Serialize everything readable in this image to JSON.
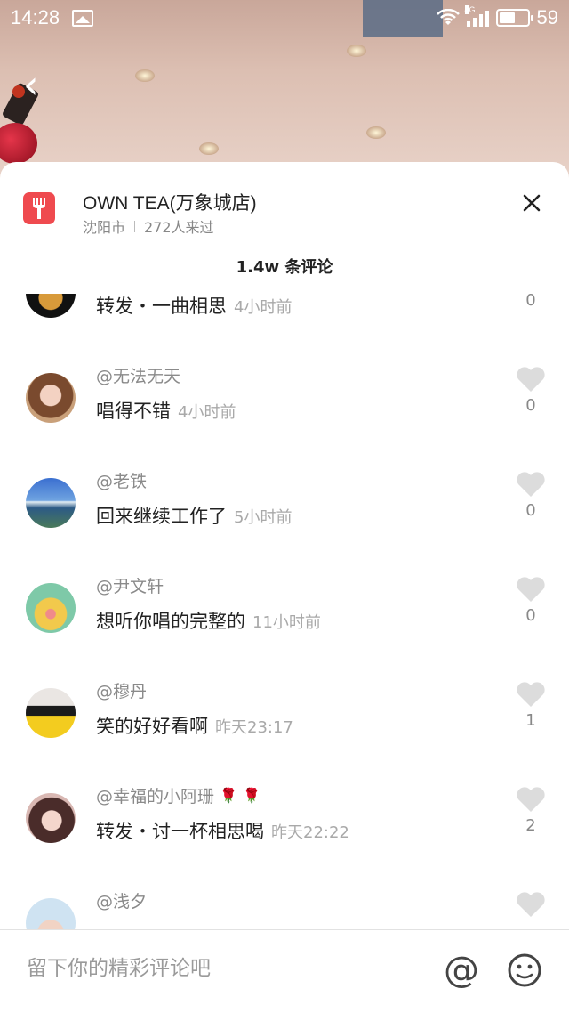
{
  "status_bar": {
    "time": "14:28",
    "network": "4G",
    "battery": "59",
    "battery_level": 0.59
  },
  "header": {
    "back_icon": "chevron-left-icon"
  },
  "shop": {
    "icon": "fork-icon",
    "name": "OWN TEA(万象城店)",
    "city": "沈阳市",
    "visitors": "272人来过"
  },
  "comments_title": "1.4w 条评论",
  "comments": [
    {
      "user": "",
      "text": "转发・一曲相思",
      "time": "4小时前",
      "likes": "0"
    },
    {
      "user": "@无法无天",
      "text": "唱得不错",
      "time": "4小时前",
      "likes": "0"
    },
    {
      "user": "@老铁",
      "text": "回来继续工作了",
      "time": "5小时前",
      "likes": "0"
    },
    {
      "user": "@尹文轩",
      "text": "想听你唱的完整的",
      "time": "11小时前",
      "likes": "0"
    },
    {
      "user": "@穆丹",
      "text": "笑的好好看啊",
      "time": "昨天23:17",
      "likes": "1"
    },
    {
      "user": "@幸福的小阿珊",
      "text": "转发・讨一杯相思喝",
      "time": "昨天22:22",
      "likes": "2"
    },
    {
      "user": "@浅夕",
      "text": "",
      "time": "",
      "likes": ""
    }
  ],
  "composer": {
    "placeholder": "留下你的精彩评论吧",
    "at_label": "@",
    "emoji_icon": "smiley-icon"
  },
  "colors": {
    "brand_red": "#ef4a4f",
    "heart_gray": "#d9d9d9"
  }
}
